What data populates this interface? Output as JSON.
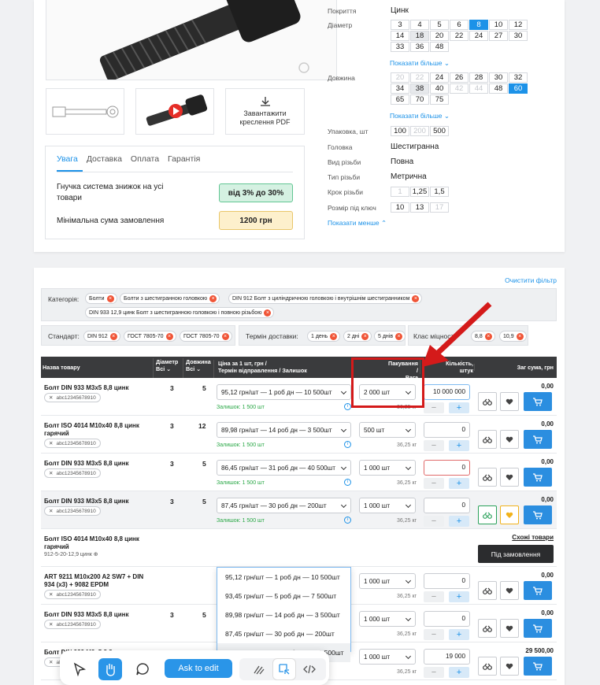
{
  "product": {
    "pdf_label_1": "Завантажити",
    "pdf_label_2": "креслення PDF",
    "tabs": [
      "Увага",
      "Доставка",
      "Оплата",
      "Гарантія"
    ],
    "discount_text_1": "Гнучка система знижок на усі",
    "discount_text_2": "товари",
    "discount_value": "від 3% до 30%",
    "min_sum_text": "Мінімальна сума замовлення",
    "min_sum_value": "1200 грн"
  },
  "attrs": {
    "coating_label": "Покриття",
    "coating_value": "Цинк",
    "diameter_label": "Діаметр",
    "diameter_values": [
      "3",
      "4",
      "5",
      "6",
      "8",
      "10",
      "12",
      "14",
      "18",
      "20",
      "22",
      "24",
      "27",
      "30",
      "33",
      "36",
      "48"
    ],
    "show_more": "Показати більше",
    "length_label": "Довжина",
    "length_values": [
      "20",
      "22",
      "24",
      "26",
      "28",
      "30",
      "32",
      "34",
      "38",
      "40",
      "42",
      "44",
      "48",
      "60",
      "65",
      "70",
      "75"
    ],
    "pack_label": "Упаковка, шт",
    "pack_values": [
      "100",
      "200",
      "500"
    ],
    "head_label": "Головка",
    "head_value": "Шестигранна",
    "thread_label": "Вид різьби",
    "thread_value": "Повна",
    "thread_type_label": "Тип різьби",
    "thread_type_value": "Метрична",
    "pitch_label": "Крок різьби",
    "pitch_values": [
      "1",
      "1,25",
      "1,5"
    ],
    "key_label": "Розмір під ключ",
    "key_values": [
      "10",
      "13",
      "17"
    ],
    "show_less": "Показати менше"
  },
  "filters": {
    "clear": "Очистити фільтр",
    "category_label": "Категорія:",
    "category_chips": [
      "Болти",
      "Болти з шестигранною головкою",
      "DIN 912 Болт з циліндричною головкою і внутрішнім шестигранником",
      "DIN 933 12,9 цинк Болт з шестигранною головкою і повною різьбою"
    ],
    "standard_label": "Стандарт:",
    "standard_chips": [
      "DIN 912",
      "ГОСТ 7805-70",
      "ГОСТ 7805-70"
    ],
    "delivery_label": "Термін доставки:",
    "delivery_chips": [
      "1 день",
      "2 дні",
      "5 днів"
    ],
    "class_label": "Клас міцності:",
    "class_chips": [
      "8,8",
      "10,9"
    ]
  },
  "table": {
    "h_name": "Назва товару",
    "h_diam": "Діаметр",
    "h_len": "Довжина",
    "h_all": "Всі",
    "h_price_1": "Ціна за 1 шт, грн /",
    "h_price_2": "Термін відправлення / Залишок",
    "h_pack_1": "Пакування /",
    "h_pack_2": "Вага",
    "h_qty_1": "Кількість,",
    "h_qty_2": "штук",
    "h_sum": "Заг сума, грн",
    "rows": [
      {
        "name": "Болт DIN 933 M3x5 8,8 цинк",
        "sku": "abc12345678910",
        "d": "3",
        "l": "5",
        "price": "95,12 грн/шт — 1 роб дн — 10 500шт",
        "stock": "Залишок: 1 500 шт",
        "pack": "2 000 шт",
        "weight": "36,25 кг",
        "qty": "10 000 000",
        "total": "0,00"
      },
      {
        "name": "Болт ISO 4014 M10x40 8,8 цинк гарячий",
        "sku": "abc12345678910",
        "d": "3",
        "l": "12",
        "price": "89,98 грн/шт — 14 роб дн — 3 500шт",
        "stock": "Залишок: 1 500 шт",
        "pack": "500 шт",
        "weight": "36,25 кг",
        "qty": "0",
        "total": "0,00"
      },
      {
        "name": "Болт DIN 933 M3x5 8,8 цинк",
        "sku": "abc12345678910",
        "d": "3",
        "l": "5",
        "price": "86,45 грн/шт — 31 роб дн — 40 500шт",
        "stock": "Залишок: 1 500 шт",
        "pack": "1 000 шт",
        "weight": "36,25 кг",
        "qty": "0",
        "total": "0,00"
      },
      {
        "name": "Болт DIN 933 M3x5 8,8 цинк",
        "sku": "abc12345678910",
        "d": "3",
        "l": "5",
        "price": "87,45 грн/шт — 30 роб дн — 200шт",
        "stock": "Залишок: 1 500 шт",
        "pack": "1 000 шт",
        "weight": "36,25 кг",
        "qty": "0",
        "total": "0,00"
      },
      {
        "name": "Болт ISO 4014 M10x40 8,8 цинк гарячий",
        "sku2": "912-5-20-12,9 цинк",
        "similar": "Схожі товари",
        "order_btn": "Під замовлення"
      },
      {
        "name": "ART 9211 M10x200 A2 SW7 + DIN 934 (x3) + 9082 EPDM",
        "sku": "abc12345678910",
        "pack": "1 000 шт",
        "weight": "36,25 кг",
        "qty": "0",
        "total": "0,00"
      },
      {
        "name": "Болт DIN 933 M3x5 8,8 цинк",
        "sku": "abc12345678910",
        "d": "3",
        "l": "5",
        "pack": "1 000 шт",
        "weight": "36,25 кг",
        "qty": "0",
        "total": "0,00"
      },
      {
        "name": "Болт DIN 933 M3x5 8,8 цинк",
        "sku": "abc12345678910",
        "d": "3",
        "l": "5",
        "pack": "1 000 шт",
        "weight": "36,25 кг",
        "qty": "19 000",
        "total": "29 500,00"
      }
    ],
    "dropdown": [
      "95,12 грн/шт — 1 роб дн — 10 500шт",
      "93,45 грн/шт — 5 роб дн — 7 500шт",
      "89,98 грн/шт — 14 роб дн — 3 500шт",
      "87,45 грн/шт — 30 роб дн — 200шт",
      "86,45 грн/шт — 31 роб дн — 40 500шт"
    ]
  },
  "toolbar": {
    "ask": "Ask to edit"
  },
  "colors": {
    "accent": "#1c92e8",
    "annotation": "#d41a1a",
    "cart": "#2b8ee0"
  }
}
